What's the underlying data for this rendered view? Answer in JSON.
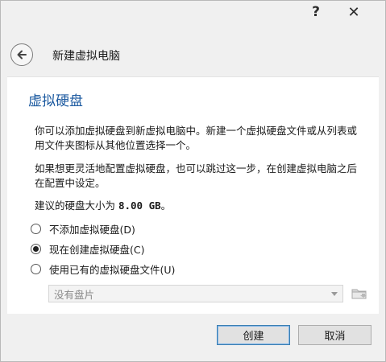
{
  "titlebar": {
    "help_label": "?",
    "close_label": "✕"
  },
  "header": {
    "title": "新建虚拟电脑"
  },
  "panel": {
    "title": "虚拟硬盘",
    "para1": "你可以添加虚拟硬盘到新虚拟电脑中。新建一个虚拟硬盘文件或从列表或用文件夹图标从其他位置选择一个。",
    "para2": "如果想更灵活地配置虚拟硬盘，也可以跳过这一步，在创建虚拟电脑之后在配置中设定。",
    "size_prefix": "建议的硬盘大小为 ",
    "size_value": "8.00 GB",
    "size_suffix": "。"
  },
  "options": [
    {
      "label": "不添加虚拟硬盘(D)",
      "selected": false
    },
    {
      "label": "现在创建虚拟硬盘(C)",
      "selected": true
    },
    {
      "label": "使用已有的虚拟硬盘文件(U)",
      "selected": false
    }
  ],
  "disk_select": {
    "value": "没有盘片"
  },
  "buttons": {
    "create": "创建",
    "cancel": "取消"
  }
}
